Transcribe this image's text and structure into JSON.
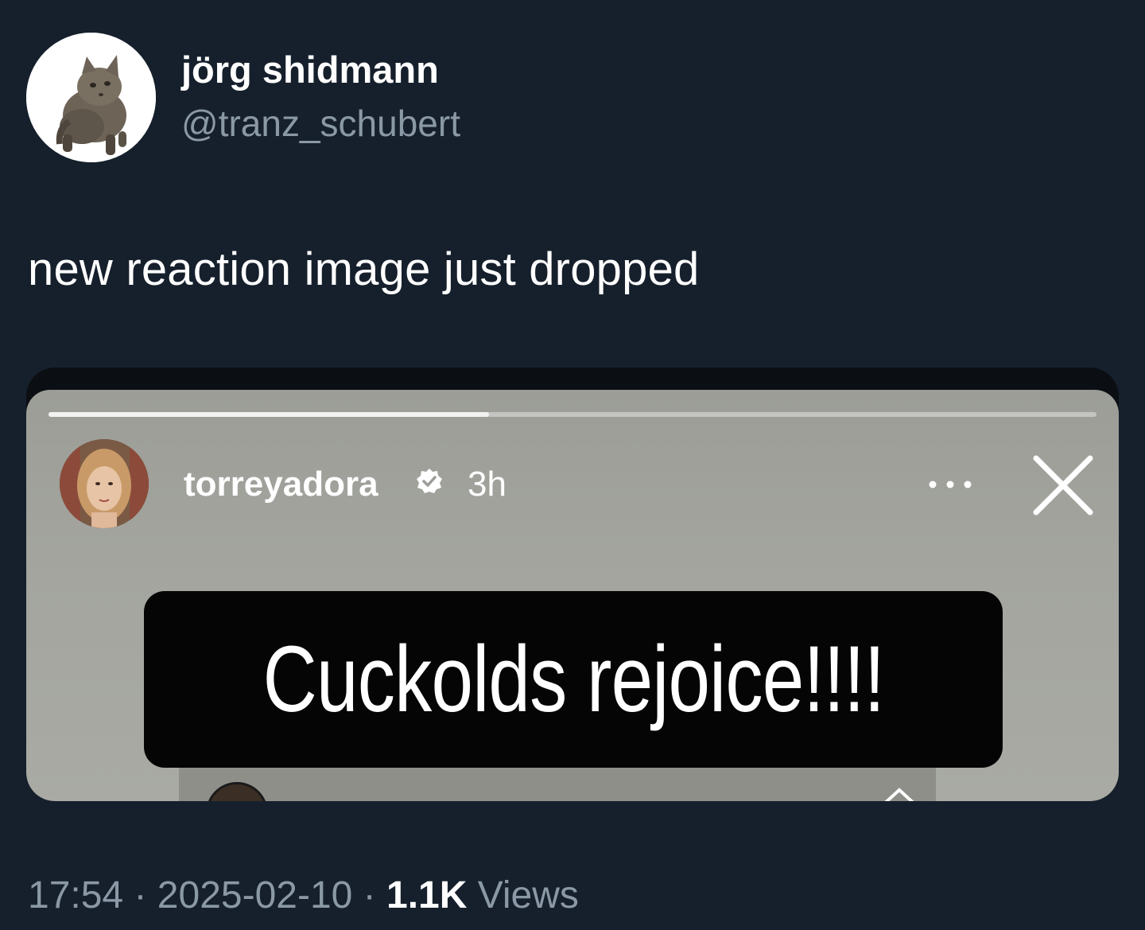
{
  "author": {
    "display_name": "jörg shidmann",
    "handle": "@tranz_schubert"
  },
  "tweet": {
    "text": "new reaction image just dropped"
  },
  "story": {
    "username": "torreyadora",
    "verified": true,
    "time_ago": "3h",
    "progress": 0.42,
    "caption": "Cuckolds rejoice!!!!"
  },
  "meta": {
    "time": "17:54",
    "separator": "·",
    "date": "2025-02-10",
    "views_count": "1.1K",
    "views_label": "Views"
  },
  "colors": {
    "background": "#16202c",
    "secondary_text": "#8b98a5"
  }
}
